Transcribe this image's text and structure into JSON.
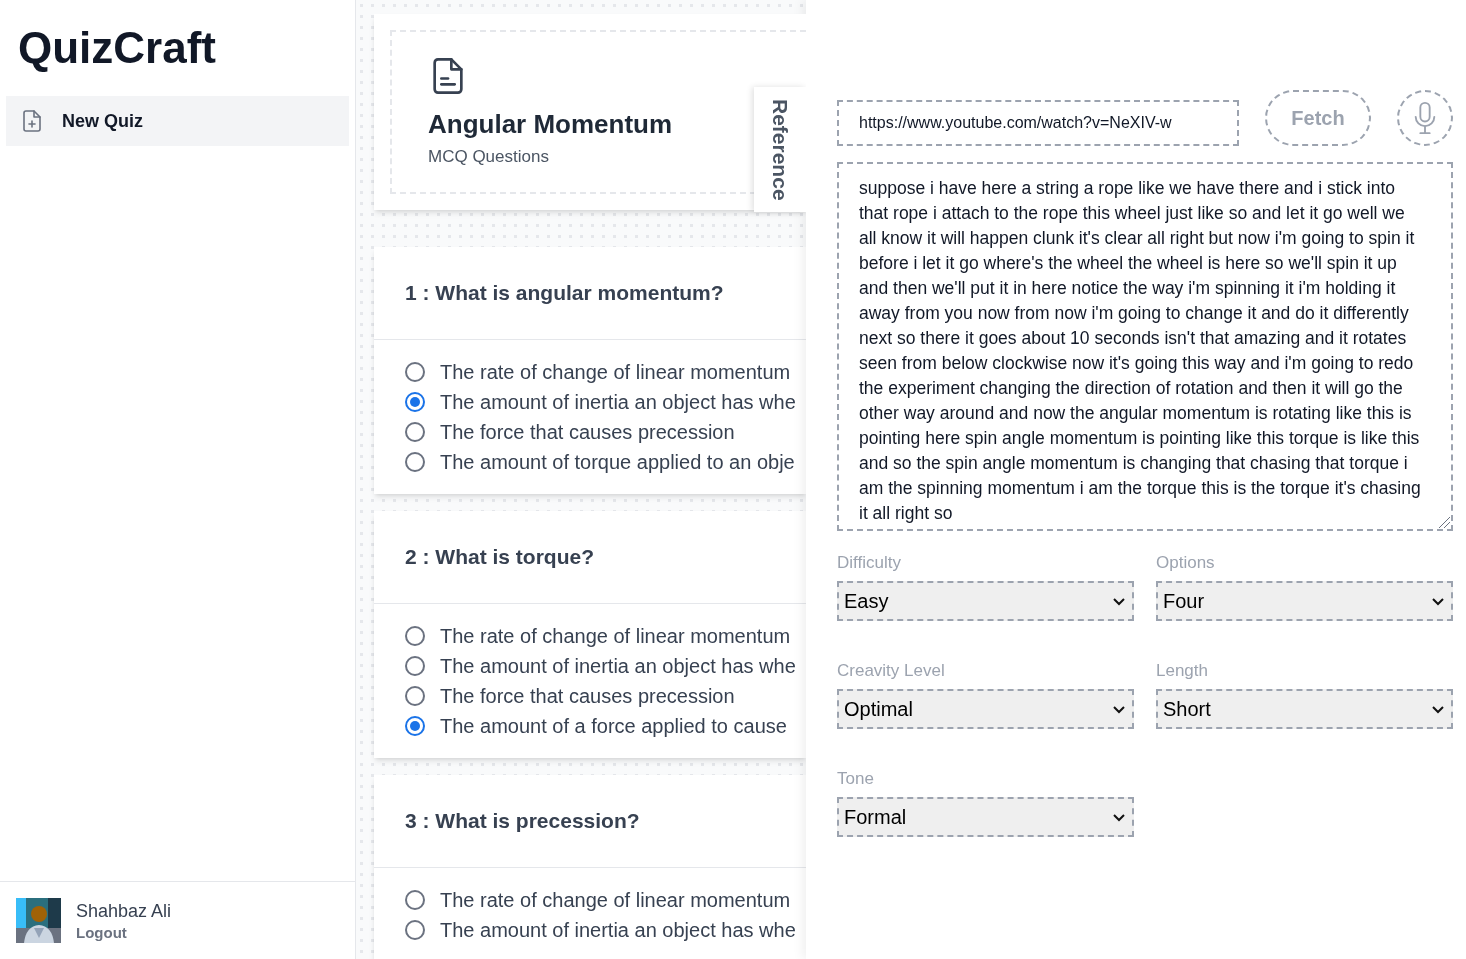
{
  "sidebar": {
    "logo": "QuizCraft",
    "items": [
      {
        "label": "New Quiz",
        "selected": true
      }
    ],
    "user": {
      "name": "Shahbaz Ali",
      "action": "Logout"
    }
  },
  "quiz": {
    "title": "Angular Momentum",
    "subtitle": "MCQ Questions",
    "reference_tab": "Reference",
    "questions": [
      {
        "heading": "1 : What is angular momentum?",
        "options": [
          {
            "label": "The rate of change of linear momentum",
            "selected": false
          },
          {
            "label": "The amount of inertia an object has whe",
            "selected": true
          },
          {
            "label": "The force that causes precession",
            "selected": false
          },
          {
            "label": "The amount of torque applied to an obje",
            "selected": false
          }
        ]
      },
      {
        "heading": "2 : What is torque?",
        "options": [
          {
            "label": "The rate of change of linear momentum",
            "selected": false
          },
          {
            "label": "The amount of inertia an object has whe",
            "selected": false
          },
          {
            "label": "The force that causes precession",
            "selected": false
          },
          {
            "label": "The amount of a force applied to cause",
            "selected": true
          }
        ]
      },
      {
        "heading": "3 : What is precession?",
        "options": [
          {
            "label": "The rate of change of linear momentum",
            "selected": false
          },
          {
            "label": "The amount of inertia an object has whe",
            "selected": false
          }
        ]
      }
    ]
  },
  "source": {
    "url": "https://www.youtube.com/watch?v=NeXIV-w",
    "fetch": {
      "label": "Fetch",
      "disabled": true
    },
    "transcript": "suppose i have here a string a rope like we have there and i stick into that rope i attach to the rope this wheel just like so and let it go well we all know it will happen clunk it's clear all right but now i'm going to spin it before i let it go where's the wheel the wheel is here so we'll spin it up and then we'll put it in here notice the way i'm spinning it i'm holding it away from you now from now i'm going to change it and do it differently next so  there it goes about 10 seconds isn't that amazing and it rotates seen from below clockwise now it's going this way and i'm going to redo the experiment changing the direction of rotation and then it will go the other way around and now the angular momentum is rotating like this is pointing here spin angle momentum is pointing like this torque is like this and so the spin angle momentum is changing that chasing that torque i am the spinning momentum i am the torque this is the torque it's chasing it all right so"
  },
  "settings": [
    {
      "label": "Difficulty",
      "value": "Easy"
    },
    {
      "label": "Options",
      "value": "Four"
    },
    {
      "label": "Creavity Level",
      "value": "Optimal"
    },
    {
      "label": "Length",
      "value": "Short"
    },
    {
      "label": "Tone",
      "value": "Formal"
    }
  ]
}
